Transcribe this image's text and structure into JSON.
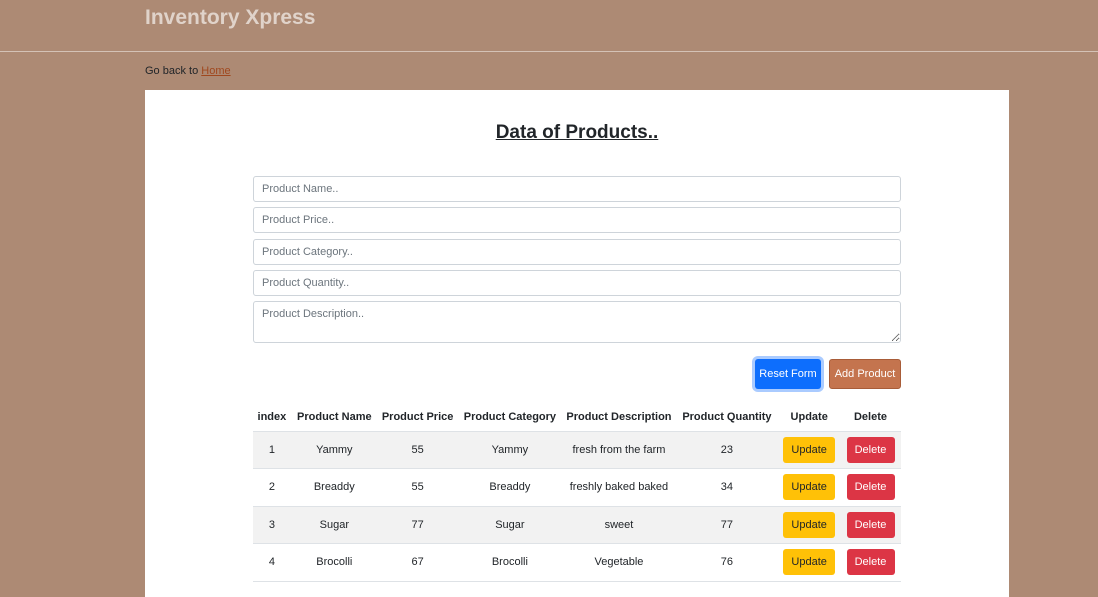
{
  "header": {
    "brand": "Inventory Xpress"
  },
  "nav": {
    "goback_text": "Go back to ",
    "home_link": "Home"
  },
  "main": {
    "title": "Data of Products..",
    "form": {
      "name_placeholder": "Product Name..",
      "price_placeholder": "Product Price..",
      "category_placeholder": "Product Category..",
      "quantity_placeholder": "Product Quantity..",
      "description_placeholder": "Product Description..",
      "reset_label": "Reset Form",
      "add_label": "Add Product"
    },
    "table": {
      "columns": [
        "index",
        "Product Name",
        "Product Price",
        "Product Category",
        "Product Description",
        "Product Quantity",
        "Update",
        "Delete"
      ],
      "rows": [
        {
          "index": "1",
          "name": "Yammy",
          "price": "55",
          "category": "Yammy",
          "description": "fresh from the farm",
          "quantity": "23",
          "update": "Update",
          "delete": "Delete"
        },
        {
          "index": "2",
          "name": "Breaddy",
          "price": "55",
          "category": "Breaddy",
          "description": "freshly baked baked",
          "quantity": "34",
          "update": "Update",
          "delete": "Delete"
        },
        {
          "index": "3",
          "name": "Sugar",
          "price": "77",
          "category": "Sugar",
          "description": "sweet",
          "quantity": "77",
          "update": "Update",
          "delete": "Delete"
        },
        {
          "index": "4",
          "name": "Brocolli",
          "price": "67",
          "category": "Brocolli",
          "description": "Vegetable",
          "quantity": "76",
          "update": "Update",
          "delete": "Delete"
        }
      ]
    }
  },
  "colors": {
    "background": "#ad8a74",
    "reset_button": "#0d6efd",
    "add_button": "#c4744e",
    "update_button": "#ffc107",
    "delete_button": "#dc3545"
  }
}
